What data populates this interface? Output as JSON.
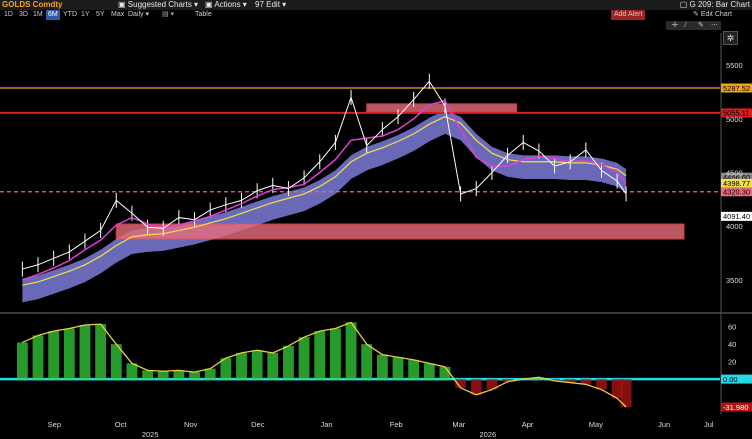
{
  "header": {
    "ticker": "GOLDS Comdty",
    "menu": [
      "Suggested Charts",
      "Actions",
      "Edit"
    ],
    "chart_title": "G 209: Bar Chart"
  },
  "toolbar": {
    "ranges": [
      "1D",
      "3D",
      "1M",
      "6M",
      "YTD",
      "1Y",
      "5Y",
      "Max"
    ],
    "selected_range": "6M",
    "period": "Daily",
    "table_label": "Table",
    "add_alert": "Add Alert",
    "edit_chart": "Edit Chart"
  },
  "colors": {
    "price": "#ffffff",
    "ma_fast": "#e23fd2",
    "ma_slow": "#f0e04a",
    "cloud": "#7b7bd8",
    "zone": "#e86d7c",
    "hline_orange": "#f0a21e",
    "hline_red": "#d81e1e",
    "osc_green": "#35cc3a",
    "osc_red": "#b31414",
    "osc_yellow": "#e6d23c",
    "zero": "#26d8e6"
  },
  "chart_data": [
    {
      "type": "line",
      "panel": "price",
      "ylim": [
        3200,
        5800
      ],
      "yticks": [
        3500,
        4000,
        4500,
        5000,
        5500
      ],
      "x": [
        "2025-09-01",
        "2025-09-08",
        "2025-09-15",
        "2025-09-22",
        "2025-09-29",
        "2025-10-06",
        "2025-10-13",
        "2025-10-20",
        "2025-10-27",
        "2025-11-03",
        "2025-11-10",
        "2025-11-17",
        "2025-11-24",
        "2025-12-01",
        "2025-12-08",
        "2025-12-15",
        "2025-12-22",
        "2025-12-29",
        "2026-01-05",
        "2026-01-12",
        "2026-01-19",
        "2026-01-26",
        "2026-02-02",
        "2026-02-09",
        "2026-02-16",
        "2026-02-23",
        "2026-03-02",
        "2026-03-09",
        "2026-03-16",
        "2026-03-23",
        "2026-03-30",
        "2026-04-06",
        "2026-04-13",
        "2026-04-20",
        "2026-04-27",
        "2026-05-04",
        "2026-05-11",
        "2026-05-18",
        "2026-05-25",
        "2026-05-29"
      ],
      "series": [
        {
          "values": [
            3600,
            3640,
            3700,
            3760,
            3860,
            3960,
            4240,
            4120,
            3990,
            3980,
            4080,
            4060,
            4150,
            4200,
            4240,
            4330,
            4380,
            4350,
            4450,
            4600,
            4780,
            5200,
            4750,
            4900,
            5020,
            5180,
            5350,
            5120,
            4300,
            4350,
            4500,
            4660,
            4780,
            4700,
            4560,
            4600,
            4710,
            4520,
            4420,
            4300
          ]
        },
        {
          "values": [
            3500,
            3550,
            3610,
            3680,
            3780,
            3870,
            4010,
            4080,
            4020,
            3990,
            4010,
            4050,
            4090,
            4150,
            4210,
            4280,
            4340,
            4360,
            4390,
            4500,
            4620,
            4800,
            4820,
            4840,
            4900,
            5000,
            5130,
            5170,
            4900,
            4640,
            4560,
            4560,
            4620,
            4650,
            4630,
            4600,
            4610,
            4570,
            4500,
            4400
          ]
        },
        {
          "values": [
            3450,
            3480,
            3530,
            3580,
            3640,
            3720,
            3820,
            3900,
            3920,
            3930,
            3960,
            3990,
            4030,
            4070,
            4120,
            4170,
            4220,
            4260,
            4300,
            4370,
            4460,
            4600,
            4680,
            4730,
            4790,
            4860,
            4950,
            5020,
            4960,
            4800,
            4680,
            4620,
            4600,
            4600,
            4600,
            4590,
            4590,
            4570,
            4530,
            4470
          ]
        }
      ],
      "hlines": [
        {
          "value": 5287.52,
          "label": "5287.52",
          "color": "#f0a21e"
        },
        {
          "value": 5055.11,
          "label": "5055.11",
          "color": "#d81e1e"
        },
        {
          "value": 4456.6,
          "label": "4456.60",
          "color": "#8a8a8a"
        },
        {
          "value": 4398.77,
          "label": "4398.77",
          "color": "#f0e04a"
        },
        {
          "value": 4320.3,
          "label": "4320.30",
          "color": "#e86d7c"
        },
        {
          "value": 4091.4,
          "label": "4091.40",
          "color": "#ffffff"
        }
      ],
      "zones": [
        {
          "x": [
            "2025-10-13",
            "2026-07-06"
          ],
          "y": [
            3880,
            4020
          ]
        },
        {
          "x": [
            "2026-02-02",
            "2026-04-10"
          ],
          "y": [
            5060,
            5140
          ]
        }
      ]
    },
    {
      "type": "bar",
      "panel": "oscillator",
      "ylim": [
        -40,
        70
      ],
      "yticks": [
        60,
        40,
        20,
        0
      ],
      "x": [
        "2025-09-01",
        "2025-09-08",
        "2025-09-15",
        "2025-09-22",
        "2025-09-29",
        "2025-10-06",
        "2025-10-13",
        "2025-10-20",
        "2025-10-27",
        "2025-11-03",
        "2025-11-10",
        "2025-11-17",
        "2025-11-24",
        "2025-12-01",
        "2025-12-08",
        "2025-12-15",
        "2025-12-22",
        "2025-12-29",
        "2026-01-05",
        "2026-01-12",
        "2026-01-19",
        "2026-01-26",
        "2026-02-02",
        "2026-02-09",
        "2026-02-16",
        "2026-02-23",
        "2026-03-02",
        "2026-03-09",
        "2026-03-16",
        "2026-03-23",
        "2026-03-30",
        "2026-04-06",
        "2026-04-13",
        "2026-04-20",
        "2026-04-27",
        "2026-05-04",
        "2026-05-11",
        "2026-05-18",
        "2026-05-25",
        "2026-05-29"
      ],
      "values": [
        42,
        50,
        55,
        58,
        62,
        63,
        40,
        18,
        10,
        9,
        10,
        8,
        12,
        24,
        30,
        33,
        30,
        38,
        48,
        55,
        58,
        65,
        40,
        28,
        25,
        22,
        18,
        14,
        -10,
        -18,
        -12,
        -3,
        0,
        2,
        -2,
        -4,
        -6,
        -12,
        -22,
        -31.98
      ],
      "labels": [
        {
          "value": 0.0,
          "label": "0.00"
        },
        {
          "value": -31.98,
          "label": "-31.980"
        }
      ],
      "xticks": [
        "Sep",
        "Oct",
        "Nov",
        "Dec",
        "Jan",
        "Feb",
        "Mar",
        "Apr",
        "May",
        "Jun",
        "Jul"
      ],
      "years": [
        "2025",
        "2026"
      ]
    }
  ]
}
